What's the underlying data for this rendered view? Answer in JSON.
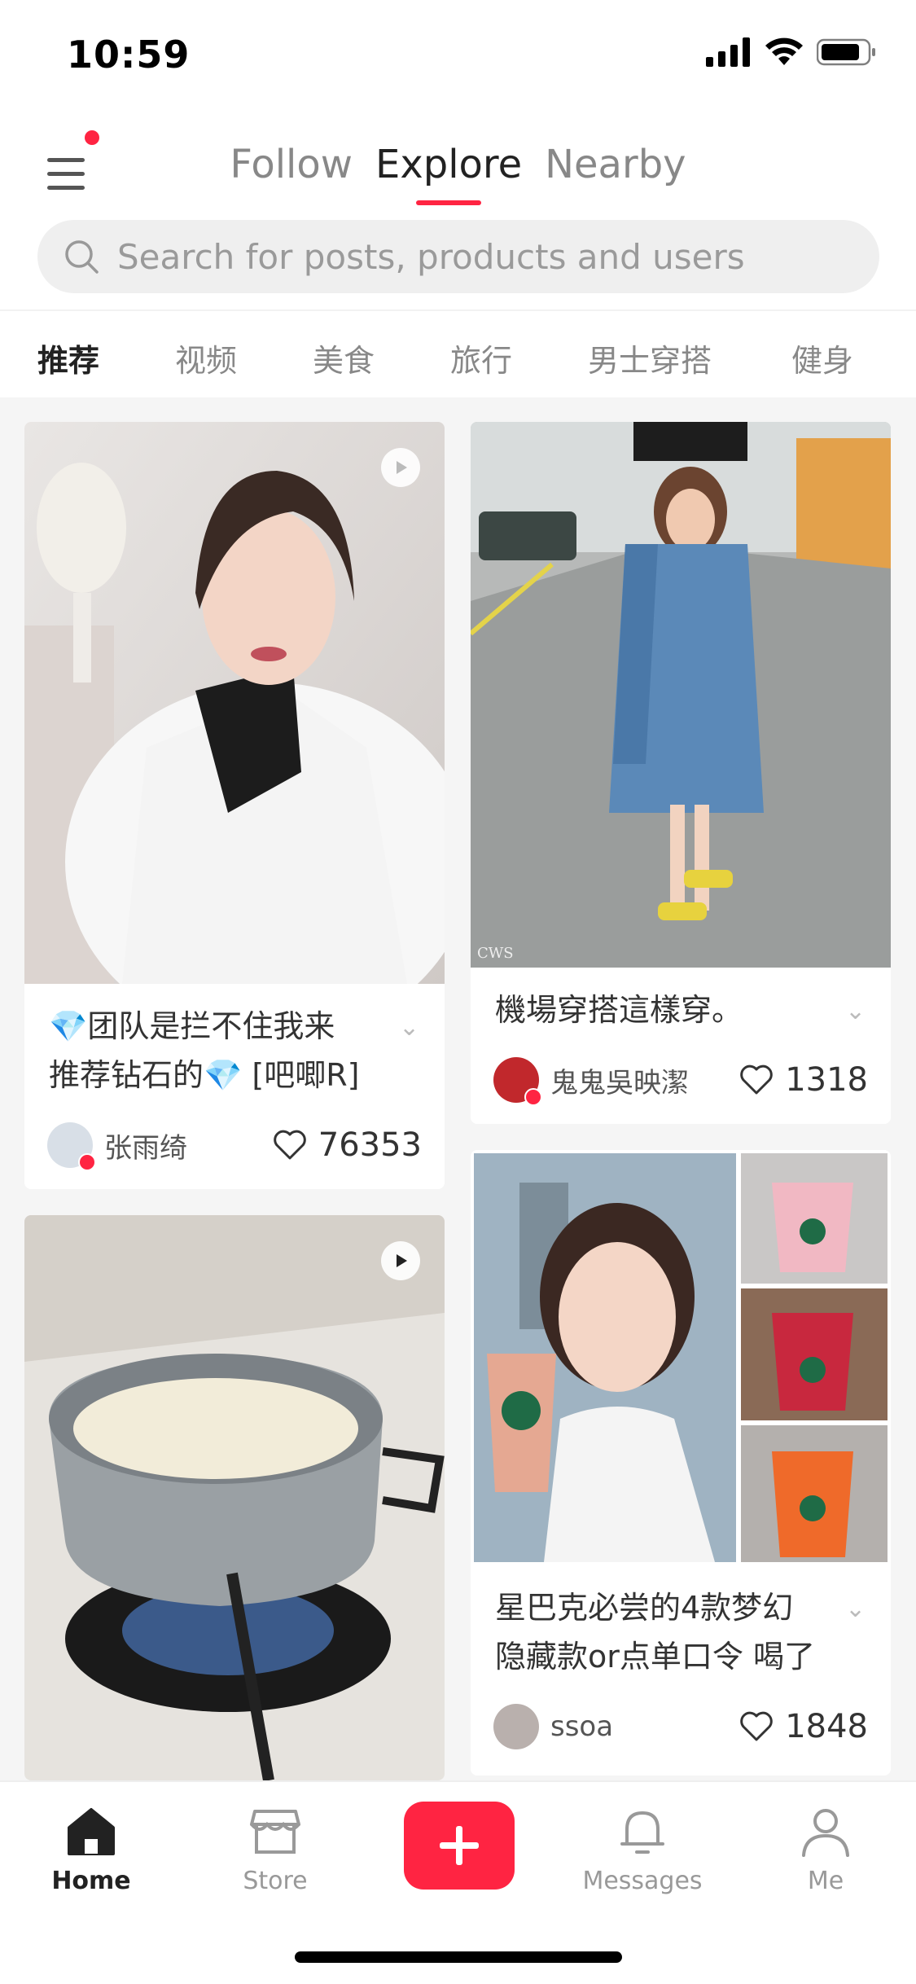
{
  "status_bar": {
    "time": "10:59"
  },
  "header": {
    "tabs": [
      {
        "label": "Follow"
      },
      {
        "label": "Explore"
      },
      {
        "label": "Nearby"
      }
    ],
    "active_tab": "Explore",
    "search_placeholder": "Search for posts, products and users"
  },
  "categories": [
    {
      "label": "推荐"
    },
    {
      "label": "视频"
    },
    {
      "label": "美食"
    },
    {
      "label": "旅行"
    },
    {
      "label": "男士穿搭"
    },
    {
      "label": "健身"
    }
  ],
  "posts": [
    {
      "title_line1": "💎团队是拦不住我来",
      "title_line2": "推荐钻石的💎 [吧唧R]",
      "author": "张雨绮",
      "likes": "76353",
      "is_video": true
    },
    {
      "title_line1": "機場穿搭這樣穿。",
      "title_line2": "",
      "author": "鬼鬼吳映潔",
      "likes": "1318",
      "is_video": false
    },
    {
      "title_line1": "星巴克必尝的4款梦幻",
      "title_line2": "隐藏款or点单口令 喝了",
      "author": "ssoa",
      "likes": "1848",
      "is_video": false
    },
    {
      "title_line1": "",
      "title_line2": "",
      "author": "",
      "likes": "",
      "is_video": true
    }
  ],
  "image_watermark": "CWS",
  "tabbar": [
    {
      "label": "Home",
      "icon": "home-icon"
    },
    {
      "label": "Store",
      "icon": "store-icon"
    },
    {
      "label": "",
      "icon": "plus-icon"
    },
    {
      "label": "Messages",
      "icon": "bell-icon"
    },
    {
      "label": "Me",
      "icon": "person-icon"
    }
  ],
  "colors": {
    "accent": "#ff2442"
  }
}
